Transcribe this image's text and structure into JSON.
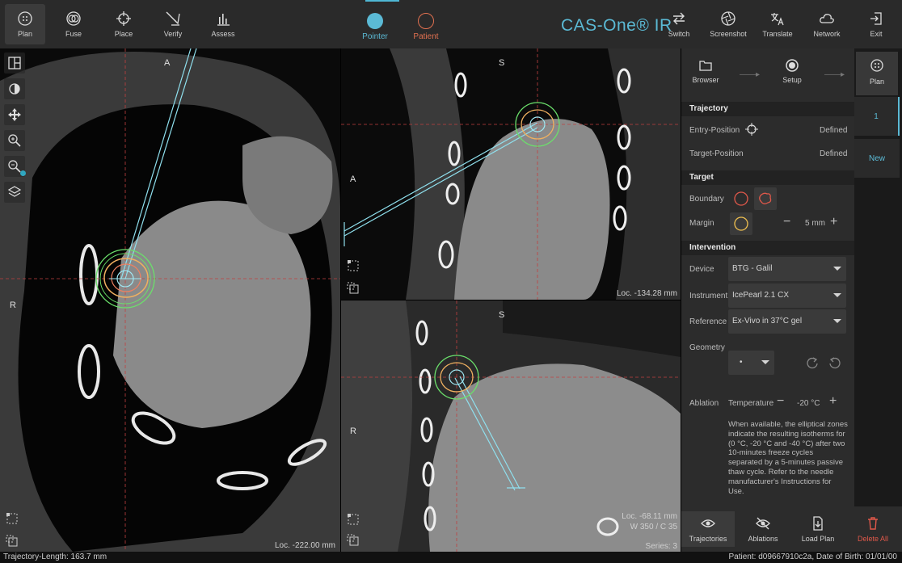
{
  "toolbar": {
    "left": [
      {
        "label": "Plan",
        "icon": "plan-icon"
      },
      {
        "label": "Fuse",
        "icon": "fuse-icon"
      },
      {
        "label": "Place",
        "icon": "crosshair-icon"
      },
      {
        "label": "Verify",
        "icon": "verify-icon"
      },
      {
        "label": "Assess",
        "icon": "bar-chart-icon"
      }
    ],
    "modes": {
      "pointer": "Pointer",
      "patient": "Patient"
    },
    "brand": "CAS-One® IR",
    "right": [
      {
        "label": "Switch",
        "icon": "switch-icon"
      },
      {
        "label": "Screenshot",
        "icon": "aperture-icon"
      },
      {
        "label": "Translate",
        "icon": "translate-icon"
      },
      {
        "label": "Network",
        "icon": "cloud-icon"
      },
      {
        "label": "Exit",
        "icon": "exit-icon"
      }
    ]
  },
  "viewports": {
    "axial": {
      "top": "A",
      "left": "R",
      "loc": "Loc. -222.00 mm"
    },
    "sagittal": {
      "top": "S",
      "left": "A",
      "loc": "Loc. -134.28 mm"
    },
    "coronal": {
      "top": "S",
      "left": "R",
      "loc": "Loc. -68.11 mm",
      "window": "W 350 / C 35",
      "series": "Series: 3"
    }
  },
  "workflow": {
    "browser": "Browser",
    "setup": "Setup",
    "plan": "Plan"
  },
  "panel": {
    "trajectory": {
      "title": "Trajectory",
      "entry_label": "Entry-Position",
      "entry_value": "Defined",
      "target_label": "Target-Position",
      "target_value": "Defined"
    },
    "target": {
      "title": "Target",
      "boundary_label": "Boundary",
      "margin_label": "Margin",
      "margin_value": "5 mm"
    },
    "intervention": {
      "title": "Intervention",
      "device_label": "Device",
      "device_value": "BTG - Galil",
      "instrument_label": "Instrument",
      "instrument_value": "IcePearl 2.1 CX",
      "reference_label": "Reference",
      "reference_value": "Ex-Vivo in 37°C gel",
      "geometry_label": "Geometry",
      "geometry_value": "•",
      "ablation_label": "Ablation",
      "temperature_label": "Temperature",
      "temperature_value": "-20 °C",
      "note": "When available, the elliptical zones indicate the resulting isotherms for (0 °C, -20 °C and -40 °C) after two 10-minutes freeze cycles separated by a 5-minutes passive thaw cycle. Refer to the needle manufacturer's Instructions for Use."
    }
  },
  "trajectory_tabs": {
    "first": "1",
    "new": "New"
  },
  "actions": {
    "trajectories": "Trajectories",
    "ablations": "Ablations",
    "load_plan": "Load Plan",
    "delete_all": "Delete All"
  },
  "status": {
    "left": "Trajectory-Length: 163.7 mm",
    "right": "Patient: d09667910c2a, Date of Birth: 01/01/00"
  },
  "colors": {
    "accent": "#5bbad5",
    "delete": "#e0584a",
    "patient": "#e07050"
  }
}
